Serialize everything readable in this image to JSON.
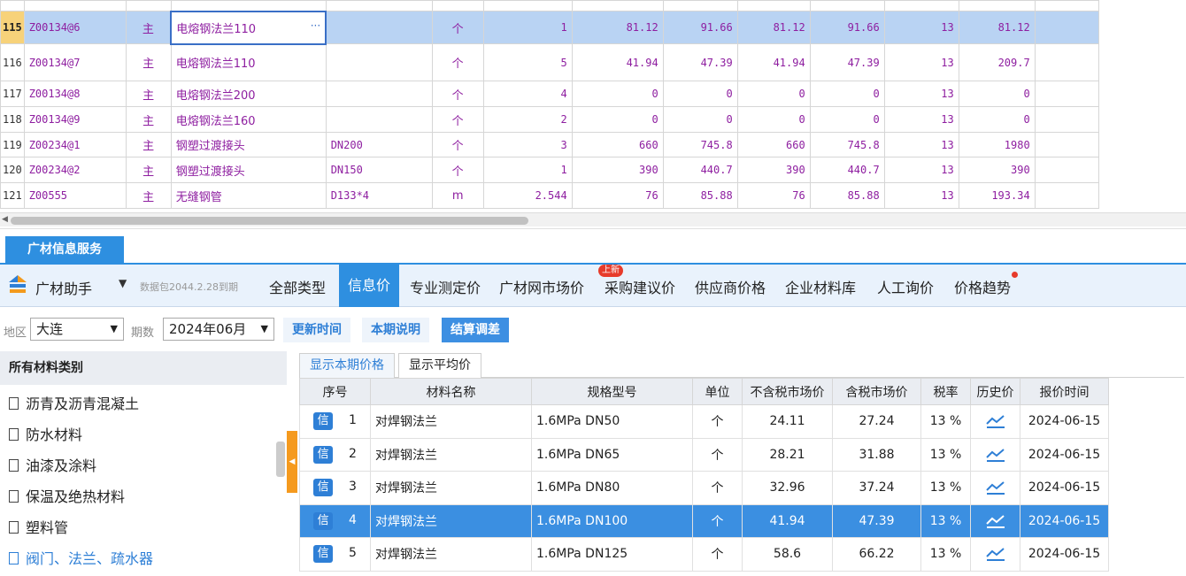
{
  "grid": {
    "rows": [
      {
        "rownum": "115",
        "code": "Z00134@6",
        "main": "主",
        "name": "电熔钢法兰110",
        "spec": "",
        "unit": "个",
        "qty": "1",
        "p1": "81.12",
        "p2": "91.66",
        "p3": "81.12",
        "p4": "91.66",
        "tax": "13",
        "total": "81.12",
        "selected": true
      },
      {
        "rownum": "116",
        "code": "Z00134@7",
        "main": "主",
        "name": "电熔钢法兰110",
        "spec": "",
        "unit": "个",
        "qty": "5",
        "p1": "41.94",
        "p2": "47.39",
        "p3": "41.94",
        "p4": "47.39",
        "tax": "13",
        "total": "209.7"
      },
      {
        "rownum": "117",
        "code": "Z00134@8",
        "main": "主",
        "name": "电熔钢法兰200",
        "spec": "",
        "unit": "个",
        "qty": "4",
        "p1": "0",
        "p2": "0",
        "p3": "0",
        "p4": "0",
        "tax": "13",
        "total": "0"
      },
      {
        "rownum": "118",
        "code": "Z00134@9",
        "main": "主",
        "name": "电熔钢法兰160",
        "spec": "",
        "unit": "个",
        "qty": "2",
        "p1": "0",
        "p2": "0",
        "p3": "0",
        "p4": "0",
        "tax": "13",
        "total": "0"
      },
      {
        "rownum": "119",
        "code": "Z00234@1",
        "main": "主",
        "name": "钢塑过渡接头",
        "spec": "DN200",
        "unit": "个",
        "qty": "3",
        "p1": "660",
        "p2": "745.8",
        "p3": "660",
        "p4": "745.8",
        "tax": "13",
        "total": "1980"
      },
      {
        "rownum": "120",
        "code": "Z00234@2",
        "main": "主",
        "name": "钢塑过渡接头",
        "spec": "DN150",
        "unit": "个",
        "qty": "1",
        "p1": "390",
        "p2": "440.7",
        "p3": "390",
        "p4": "440.7",
        "tax": "13",
        "total": "390"
      },
      {
        "rownum": "121",
        "code": "Z00555",
        "main": "主",
        "name": "无缝钢管",
        "spec": "D133*4",
        "unit": "m",
        "qty": "2.544",
        "p1": "76",
        "p2": "85.88",
        "p3": "76",
        "p4": "85.88",
        "tax": "13",
        "total": "193.34"
      }
    ]
  },
  "service_tab": "广材信息服务",
  "assistant": "广材助手",
  "package_note": "数据包2044.2.28到期",
  "tabs": {
    "all": "全部类型",
    "info": "信息价",
    "pro": "专业测定价",
    "net": "广材网市场价",
    "purchase": "采购建议价",
    "supplier": "供应商价格",
    "enterprise": "企业材料库",
    "manual": "人工询价",
    "trend": "价格趋势",
    "new_badge": "上新"
  },
  "filter": {
    "region_label": "地区",
    "region": "大连",
    "period_label": "期数",
    "period": "2024年06月",
    "update_btn": "更新时间",
    "note_btn": "本期说明",
    "settle_btn": "结算调差"
  },
  "categories": {
    "header": "所有材料类别",
    "items": [
      "沥青及沥青混凝土",
      "防水材料",
      "油漆及涂料",
      "保温及绝热材料",
      "塑料管",
      "阀门、法兰、疏水器"
    ]
  },
  "price_tabs": {
    "current": "显示本期价格",
    "average": "显示平均价"
  },
  "price_table": {
    "headers": [
      "序号",
      "材料名称",
      "规格型号",
      "单位",
      "不含税市场价",
      "含税市场价",
      "税率",
      "历史价",
      "报价时间"
    ],
    "rows": [
      {
        "tag": "信",
        "no": "1",
        "name": "对焊钢法兰",
        "spec": "1.6MPa DN50",
        "unit": "个",
        "ex": "24.11",
        "inc": "27.24",
        "tax": "13 %",
        "date": "2024-06-15"
      },
      {
        "tag": "信",
        "no": "2",
        "name": "对焊钢法兰",
        "spec": "1.6MPa DN65",
        "unit": "个",
        "ex": "28.21",
        "inc": "31.88",
        "tax": "13 %",
        "date": "2024-06-15"
      },
      {
        "tag": "信",
        "no": "3",
        "name": "对焊钢法兰",
        "spec": "1.6MPa DN80",
        "unit": "个",
        "ex": "32.96",
        "inc": "37.24",
        "tax": "13 %",
        "date": "2024-06-15"
      },
      {
        "tag": "信",
        "no": "4",
        "name": "对焊钢法兰",
        "spec": "1.6MPa DN100",
        "unit": "个",
        "ex": "41.94",
        "inc": "47.39",
        "tax": "13 %",
        "date": "2024-06-15",
        "selected": true
      },
      {
        "tag": "信",
        "no": "5",
        "name": "对焊钢法兰",
        "spec": "1.6MPa DN125",
        "unit": "个",
        "ex": "58.6",
        "inc": "66.22",
        "tax": "13 %",
        "date": "2024-06-15"
      }
    ]
  }
}
